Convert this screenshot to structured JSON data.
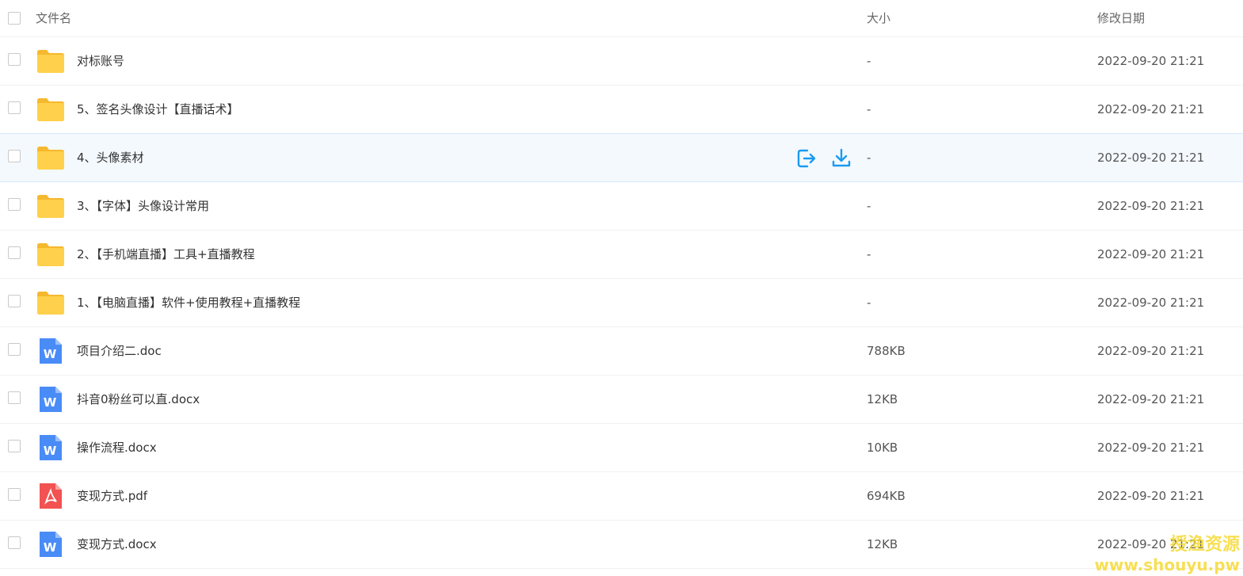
{
  "header": {
    "name_label": "文件名",
    "size_label": "大小",
    "date_label": "修改日期"
  },
  "colors": {
    "folder": "#FFD04B",
    "word": "#4A8CF7",
    "pdf": "#F25252",
    "action": "#1A9BF0"
  },
  "rows": [
    {
      "name": "对标账号",
      "type": "folder",
      "size": "-",
      "date": "2022-09-20 21:21"
    },
    {
      "name": "5、签名头像设计【直播话术】",
      "type": "folder",
      "size": "-",
      "date": "2022-09-20 21:21"
    },
    {
      "name": "4、头像素材",
      "type": "folder",
      "size": "-",
      "date": "2022-09-20 21:21",
      "hovered": true
    },
    {
      "name": "3、【字体】头像设计常用",
      "type": "folder",
      "size": "-",
      "date": "2022-09-20 21:21"
    },
    {
      "name": "2、【手机端直播】工具+直播教程",
      "type": "folder",
      "size": "-",
      "date": "2022-09-20 21:21"
    },
    {
      "name": "1、【电脑直播】软件+使用教程+直播教程",
      "type": "folder",
      "size": "-",
      "date": "2022-09-20 21:21"
    },
    {
      "name": "项目介绍二.doc",
      "type": "word",
      "size": "788KB",
      "date": "2022-09-20 21:21"
    },
    {
      "name": "抖音0粉丝可以直.docx",
      "type": "word",
      "size": "12KB",
      "date": "2022-09-20 21:21"
    },
    {
      "name": "操作流程.docx",
      "type": "word",
      "size": "10KB",
      "date": "2022-09-20 21:21"
    },
    {
      "name": "变现方式.pdf",
      "type": "pdf",
      "size": "694KB",
      "date": "2022-09-20 21:21"
    },
    {
      "name": "变现方式.docx",
      "type": "word",
      "size": "12KB",
      "date": "2022-09-20 21:21"
    }
  ],
  "icons": {
    "folder": "folder-icon",
    "word": "word-file-icon",
    "pdf": "pdf-file-icon",
    "share": "share-icon",
    "download": "download-icon"
  },
  "watermark": {
    "line1": "授渔资源",
    "line2": "www.shouyu.pw"
  }
}
